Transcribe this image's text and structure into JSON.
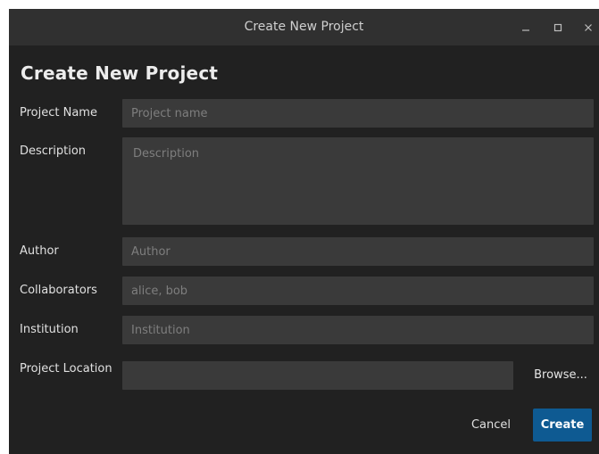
{
  "window": {
    "title": "Create New Project",
    "controls": {
      "minimize_icon": "minimize-icon",
      "maximize_icon": "maximize-icon",
      "close_icon": "close-icon"
    }
  },
  "dialog": {
    "heading": "Create New Project",
    "fields": {
      "project_name": {
        "label": "Project Name",
        "value": "",
        "placeholder": "Project name"
      },
      "description": {
        "label": "Description",
        "value": "",
        "placeholder": "Description"
      },
      "author": {
        "label": "Author",
        "value": "",
        "placeholder": "Author"
      },
      "collaborators": {
        "label": "Collaborators",
        "value": "",
        "placeholder": "alice, bob"
      },
      "institution": {
        "label": "Institution",
        "value": "",
        "placeholder": "Institution"
      },
      "project_location": {
        "label": "Project Location",
        "value": "",
        "placeholder": ""
      }
    },
    "browse_label": "Browse...",
    "cancel_label": "Cancel",
    "create_label": "Create"
  },
  "colors": {
    "background": "#212121",
    "titlebar": "#303030",
    "field": "#3a3a3a",
    "accent": "#0e5a92"
  }
}
